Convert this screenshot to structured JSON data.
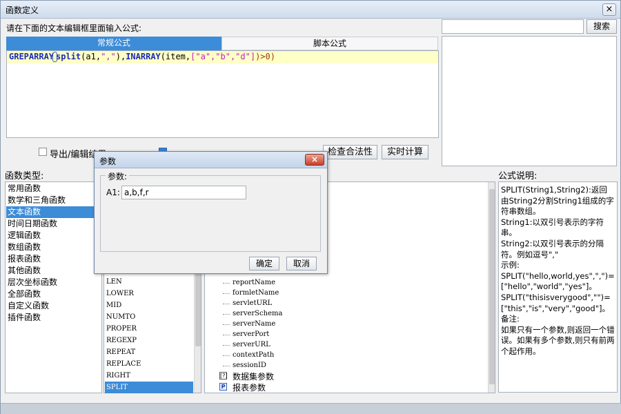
{
  "window": {
    "title": "函数定义",
    "close": "×"
  },
  "prompt": "请在下面的文本编辑框里面输入公式:",
  "search": {
    "button": "搜索",
    "value": ""
  },
  "tabs": [
    {
      "label": "常规公式",
      "active": true
    },
    {
      "label": "脚本公式",
      "active": false
    }
  ],
  "editor": {
    "formula": "GREPARRAY(split(a1,\",\"),INARRAY(item,[\"a\",\"b\",\"d\"])>0)",
    "parts": {
      "p1": "GREPARRAY",
      "p2": "split",
      "p3": "(a1,",
      "p4": "\",\"",
      "p5": "),",
      "p6": "INARRAY",
      "p7": "(item,",
      "p8": "[\"a\",\"b\",\"d\"]",
      "p9": ")>0)"
    }
  },
  "options": {
    "export_checkbox": {
      "label": "导出/编辑结果",
      "checked": false
    },
    "second_checkbox": {
      "checked": true
    }
  },
  "buttons": {
    "check": "检查合法性",
    "realtime": "实时计算"
  },
  "function_types": {
    "label": "函数类型:",
    "items": [
      "常用函数",
      "数学和三角函数",
      "文本函数",
      "时间日期函数",
      "逻辑函数",
      "数组函数",
      "报表函数",
      "其他函数",
      "层次坐标函数",
      "全部函数",
      "自定义函数",
      "插件函数"
    ],
    "selected_index": 2
  },
  "function_list": {
    "items": [
      "LEN",
      "LOWER",
      "MID",
      "NUMTO",
      "PROPER",
      "REGEXP",
      "REPEAT",
      "REPLACE",
      "RIGHT",
      "SPLIT"
    ],
    "selected": "SPLIT"
  },
  "param_tree": {
    "items": [
      "reportName",
      "formletName",
      "servletURL",
      "serverSchema",
      "serverName",
      "serverPort",
      "serverURL",
      "contextPath",
      "sessionID"
    ],
    "groups": [
      "数据集参数",
      "报表参数"
    ],
    "group_icons": {
      "dataset": "[?]",
      "report": "P"
    }
  },
  "description": {
    "label": "公式说明:",
    "lines": [
      "SPLIT(String1,String2):返回由String2分割String1组成的字符串数组。",
      "String1:以双引号表示的字符串。",
      "String2:以双引号表示的分隔符。例如逗号\",\"",
      "示例:",
      "SPLIT(\"hello,world,yes\",\",\")=[\"hello\",\"world\",\"yes\"]。",
      "SPLIT(\"thisisverygood\",\"\")=[\"this\",\"is\",\"very\",\"good\"]。",
      "备注:",
      "如果只有一个参数,则返回一个错误。如果有多个参数,则只有前两个起作用。"
    ]
  },
  "dialog": {
    "title": "参数",
    "close": "×",
    "group_label": "参数:",
    "field_label": "A1:",
    "field_value": "a,b,f,r",
    "ok": "确定",
    "cancel": "取消"
  }
}
